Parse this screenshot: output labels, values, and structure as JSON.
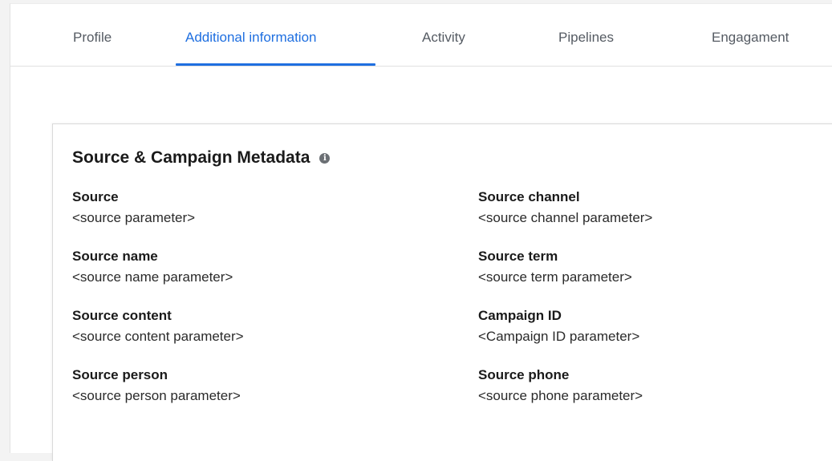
{
  "tabs": [
    {
      "label": "Profile"
    },
    {
      "label": "Additional information"
    },
    {
      "label": "Activity"
    },
    {
      "label": "Pipelines"
    },
    {
      "label": "Engagament"
    }
  ],
  "active_tab": "Additional information",
  "accent_color": "#1f6fe0",
  "card": {
    "title": "Source & Campaign Metadata",
    "title_icon": "info-icon",
    "fields": [
      {
        "label": "Source",
        "value": "<source parameter>"
      },
      {
        "label": "Source channel",
        "value": "<source channel parameter>"
      },
      {
        "label": "Source name",
        "value": "<source name parameter>"
      },
      {
        "label": "Source term",
        "value": "<source term parameter>"
      },
      {
        "label": "Source content",
        "value": "<source content parameter>"
      },
      {
        "label": "Campaign ID",
        "value": "<Campaign ID parameter>"
      },
      {
        "label": "Source person",
        "value": "<source person parameter>"
      },
      {
        "label": "Source phone",
        "value": "<source phone parameter>"
      }
    ]
  }
}
